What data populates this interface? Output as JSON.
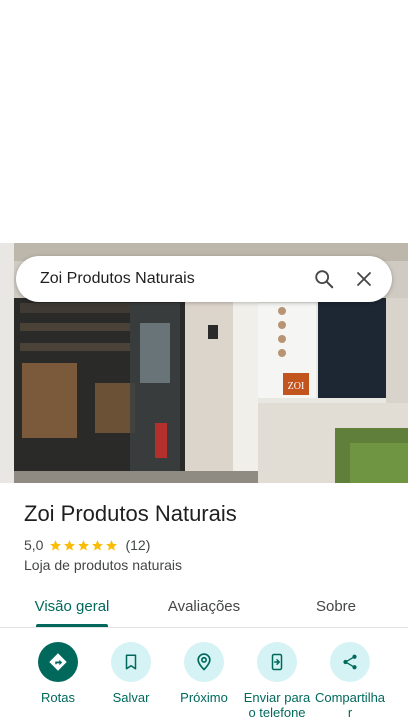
{
  "search": {
    "query": "Zoi Produtos Naturais"
  },
  "place": {
    "name": "Zoi Produtos Naturais",
    "rating": "5,0",
    "stars": 5,
    "review_count": "(12)",
    "category": "Loja de produtos naturais"
  },
  "photo": {
    "sign_text": "ZOI"
  },
  "tabs": [
    {
      "label": "Visão geral",
      "active": true
    },
    {
      "label": "Avaliações",
      "active": false
    },
    {
      "label": "Sobre",
      "active": false
    }
  ],
  "actions": [
    {
      "label": "Rotas",
      "icon": "directions-icon"
    },
    {
      "label": "Salvar",
      "icon": "bookmark-icon"
    },
    {
      "label": "Próximo",
      "icon": "nearby-icon"
    },
    {
      "label": "Enviar para o telefone",
      "icon": "send-to-phone-icon"
    },
    {
      "label": "Compartilhar",
      "icon": "share-icon"
    }
  ],
  "colors": {
    "accent": "#00695c",
    "action_bg": "#d5f3f5",
    "star": "#fbbc04",
    "text_secondary": "#444746"
  }
}
